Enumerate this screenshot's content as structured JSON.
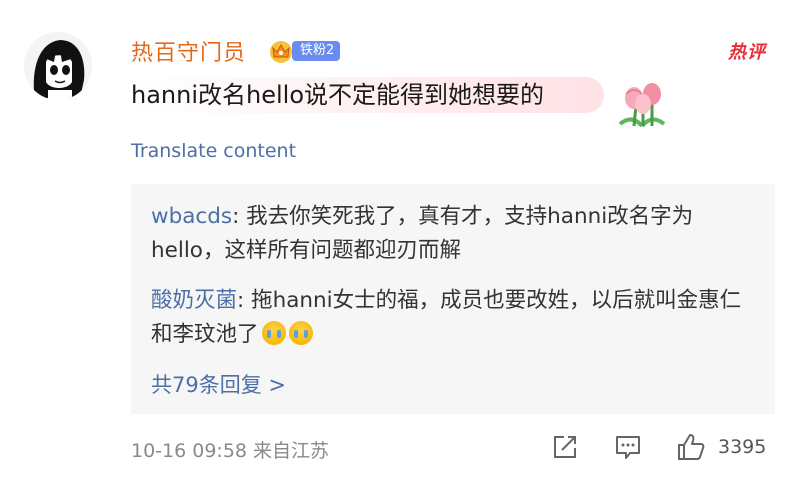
{
  "comment": {
    "username": "热百守门员",
    "badge": "铁粉2",
    "hot_tag": "热评",
    "text": "hanni改名hello说不定能得到她想要的",
    "translate": "Translate content",
    "replies": [
      {
        "name": "wbacds",
        "text": "我去你笑死我了，真有才，支持hanni改名字为hello，这样所有问题都迎刃而解"
      },
      {
        "name": "酸奶灭菌",
        "text": "拖hanni女士的福，成员也要改姓，以后就叫金惠仁和李玟池了"
      }
    ],
    "reply_count_label": "共79条回复 >",
    "timestamp": "10-16 09:58 来自江苏",
    "likes": "3395"
  },
  "icons": [
    "avatar",
    "crown-icon",
    "flower-icon",
    "crying-emoji-icon",
    "share-icon",
    "comment-icon",
    "like-icon"
  ]
}
